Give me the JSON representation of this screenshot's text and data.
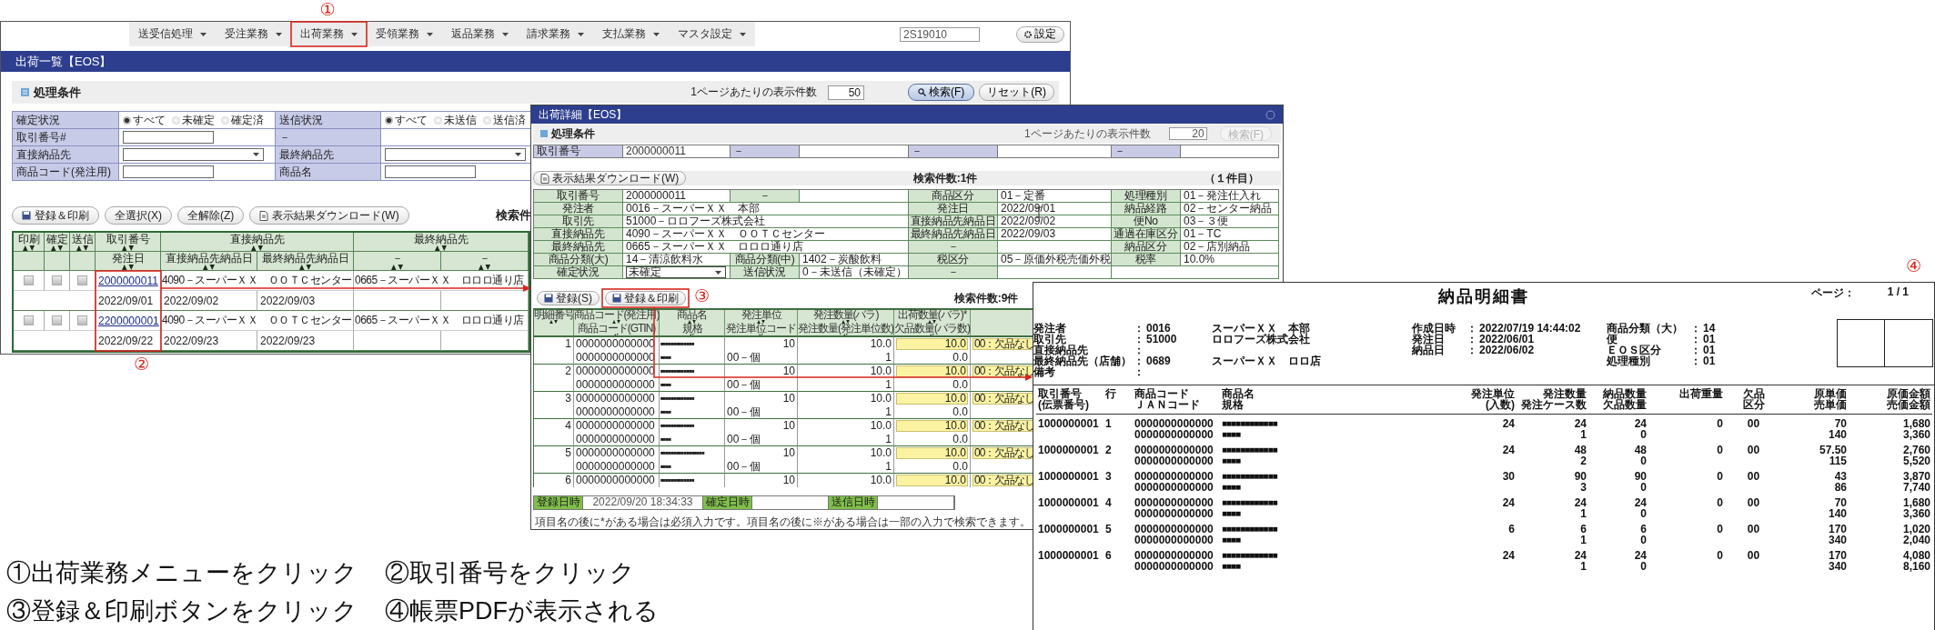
{
  "list_window": {
    "menu": [
      "送受信処理",
      "受注業務",
      "出荷業務",
      "受領業務",
      "返品業務",
      "請求業務",
      "支払業務",
      "マスタ設定"
    ],
    "user_field": "2S19010",
    "settings_button": "設定",
    "title": "出荷一覧【EOS】",
    "conditions": {
      "title": "処理条件",
      "page_size_label": "1ページあたりの表示件数",
      "page_size": "50",
      "search_button": "検索(F)",
      "reset_button": "リセット(R)",
      "rows": [
        [
          {
            "label": "確定状況",
            "kind": "radio",
            "options": [
              {
                "label": "すべて",
                "selected": true
              },
              {
                "label": "未確定",
                "selected": false
              },
              {
                "label": "確定済",
                "selected": false
              }
            ]
          },
          {
            "label": "送信状況",
            "kind": "radio",
            "options": [
              {
                "label": "すべて",
                "selected": true
              },
              {
                "label": "未送信",
                "selected": false
              },
              {
                "label": "送信済",
                "selected": false
              }
            ]
          }
        ],
        [
          {
            "label": "取引番号#",
            "kind": "input"
          },
          {
            "label": "－",
            "kind": "none"
          }
        ],
        [
          {
            "label": "直接納品先",
            "kind": "select"
          },
          {
            "label": "最終納品先",
            "kind": "select"
          }
        ],
        [
          {
            "label": "商品コード(発注用)",
            "kind": "input"
          },
          {
            "label": "商品名",
            "kind": "input"
          }
        ]
      ]
    },
    "buttons": [
      "登録＆印刷",
      "全選択(X)",
      "全解除(Z)",
      "表示結果ダウンロード(W)"
    ],
    "result_count": "検索件",
    "table": {
      "columns": [
        {
          "label": "印刷"
        },
        {
          "label": "確定"
        },
        {
          "label": "送信"
        },
        {
          "label": "取引番号",
          "sub": [
            "発注日"
          ]
        },
        {
          "label": "直接納品先",
          "sub": [
            "直接納品先納品日",
            "最終納品先納品日"
          ]
        },
        {
          "label": "最終納品先",
          "sub": [
            "－",
            "－"
          ]
        }
      ],
      "rows": [
        {
          "checks": [
            {
              "checked": false
            },
            {
              "checked": false
            },
            {
              "checked": false
            }
          ],
          "number": "2000000011",
          "direct": "4090－スーパーＸＸ　ＯＯＴＣセンター",
          "final": "0665－スーパーＸＸ　ロロロ通り店",
          "dates": [
            "2022/09/01",
            "2022/09/02",
            "2022/09/03"
          ]
        },
        {
          "checks": [
            {
              "checked": false
            },
            {
              "checked": false
            },
            {
              "checked": false
            }
          ],
          "number": "2200000001",
          "direct": "4090－スーパーＸＸ　ＯＯＴＣセンター",
          "final": "0665－スーパーＸＸ　ロロロ通り店",
          "dates": [
            "2022/09/22",
            "2022/09/23",
            "2022/09/23"
          ]
        }
      ]
    }
  },
  "detail_window": {
    "title": "出荷詳細【EOS】",
    "conditions": {
      "title": "処理条件",
      "page_size_label": "1ページあたりの表示件数",
      "page_size": "20",
      "search_button": {
        "label": "検索(F)",
        "disabled": true
      }
    },
    "key_fields": [
      {
        "label": "取引番号",
        "value": "2000000011"
      },
      {
        "label": "－"
      },
      {
        "label": "－"
      },
      {
        "label": "－"
      }
    ],
    "download_button": "表示結果ダウンロード(W)",
    "count": "検索件数:1件",
    "position": "（１件目）",
    "details": [
      [
        {
          "label": "取引番号",
          "value": "2000000011"
        },
        {
          "label": "－"
        },
        {
          "label": "商品区分",
          "value": "01－定番"
        },
        {
          "label": "処理種別",
          "value": "01－発注仕入れ"
        }
      ],
      [
        {
          "label": "発注者",
          "value": "0016－スーパーＸＸ　本部",
          "wide": true
        },
        {
          "label": "発注日",
          "value": "2022/09/01"
        },
        {
          "label": "納品経路",
          "value": "02－センター納品"
        }
      ],
      [
        {
          "label": "取引先",
          "value": "51000－ロロフーズ株式会社",
          "wide": true
        },
        {
          "label": "直接納品先納品日",
          "value": "2022/09/02"
        },
        {
          "label": "便No",
          "value": "03－３便"
        }
      ],
      [
        {
          "label": "直接納品先",
          "value": "4090－スーパーＸＸ　ＯＯＴＣセンター",
          "wide": true
        },
        {
          "label": "最終納品先納品日",
          "value": "2022/09/03"
        },
        {
          "label": "通過在庫区分",
          "value": "01－TC"
        }
      ],
      [
        {
          "label": "最終納品先",
          "value": "0665－スーパーＸＸ　ロロロ通り店",
          "wide": true
        },
        {
          "label": "－"
        },
        {
          "label": "納品区分",
          "value": "02－店別納品"
        }
      ],
      [
        {
          "label": "商品分類(大)",
          "value": "14－清涼飲料水"
        },
        {
          "label": "商品分類(中)",
          "value": "1402－炭酸飲料"
        },
        {
          "label": "税区分",
          "value": "05－原価外税売価外税"
        },
        {
          "label": "税率",
          "value": "10.0%"
        }
      ],
      [
        {
          "label": "確定状況",
          "value": "未確定",
          "kind": "select"
        },
        {
          "label": "送信状況",
          "value": "0－未送信（未確定）"
        },
        {
          "label": "－"
        }
      ]
    ],
    "actions": [
      "登録(S)",
      "登録＆印刷"
    ],
    "item_count": "検索件数:9件",
    "item_columns": [
      {
        "label": "明細番号"
      },
      {
        "label": "商品コード(発注用)",
        "sub": "商品コード(GTIN)"
      },
      {
        "label": "商品名",
        "sub": "規格"
      },
      {
        "label": "発注単位",
        "sub": "発注単位コード"
      },
      {
        "label": "発注数量(バラ)",
        "sub": "発注数量(発注単位数)"
      },
      {
        "label": "出荷数量(バラ)*",
        "sub": "欠品数量(バラ数)"
      }
    ],
    "items": [
      {
        "no": "1",
        "code": "0000000000000",
        "name": "■■■■■■■■■■■■■",
        "unit": "10",
        "qty": "10.0",
        "ship": "10.0",
        "shortage": "00：欠品なし",
        "gtin": "0000000000000",
        "spec": "■■■■",
        "unit_code": "00－個",
        "qty_units": "1",
        "short_qty": "0.0"
      },
      {
        "no": "2",
        "code": "0000000000000",
        "name": "■■■■■■■■■■■■■",
        "unit": "10",
        "qty": "10.0",
        "ship": "10.0",
        "shortage": "00：欠品なし",
        "gtin": "0000000000000",
        "spec": "■■■■",
        "unit_code": "00－個",
        "qty_units": "1",
        "short_qty": "0.0"
      },
      {
        "no": "3",
        "code": "0000000000000",
        "name": "■■■■■■■■■■■■■",
        "unit": "10",
        "qty": "10.0",
        "ship": "10.0",
        "shortage": "00：欠品なし",
        "gtin": "0000000000000",
        "spec": "■■■■",
        "unit_code": "00－個",
        "qty_units": "1",
        "short_qty": "0.0"
      },
      {
        "no": "4",
        "code": "0000000000000",
        "name": "■■■■■■■■■■■■■",
        "unit": "10",
        "qty": "10.0",
        "ship": "10.0",
        "shortage": "00：欠品なし",
        "gtin": "0000000000000",
        "spec": "■■■■",
        "unit_code": "00－個",
        "qty_units": "1",
        "short_qty": "0.0"
      },
      {
        "no": "5",
        "code": "0000000000000",
        "name": "■■■■■■■■■■■■■■■■■",
        "unit": "10",
        "qty": "10.0",
        "ship": "10.0",
        "shortage": "00：欠品なし",
        "gtin": "0000000000000",
        "spec": "■■■■",
        "unit_code": "00－個",
        "qty_units": "1",
        "short_qty": "0.0"
      },
      {
        "no": "6",
        "code": "0000000000000",
        "name": "■■■■■■■■■■■■■",
        "unit": "10",
        "qty": "10.0",
        "ship": "10.0",
        "shortage": "00：欠品なし"
      }
    ],
    "footer": [
      {
        "label": "登録日時",
        "value": "2022/09/20 18:34:33"
      },
      {
        "label": "確定日時"
      },
      {
        "label": "送信日時"
      }
    ],
    "note": "項目名の後に*がある場合は必須入力です。項目名の後に※がある場合は一部の入力で検索できます。"
  },
  "pdf": {
    "title": "納品明細書",
    "page_label": "ページ：",
    "page": "1 / 1",
    "meta_left": [
      {
        "label": "発注者",
        "colon": "：",
        "value": "0016",
        "name": "スーパーＸＸ　本部"
      },
      {
        "label": "取引先",
        "colon": "：",
        "value": "51000",
        "name": "ロロフーズ株式会社"
      },
      {
        "label": "直接納品先",
        "colon": "："
      },
      {
        "label": "最終納品先（店舗）",
        "colon": "：",
        "value": "0689",
        "name": "スーパーＸＸ　ロロ店"
      },
      {
        "label": "備考",
        "colon": "："
      }
    ],
    "meta_middle": [
      {
        "label": "作成日時",
        "colon": "：",
        "value": "2022/07/19 14:44:02"
      },
      {
        "label": "発注日",
        "colon": "：",
        "value": "2022/06/01"
      },
      {
        "label": "納品日",
        "colon": "：",
        "value": "2022/06/02"
      }
    ],
    "meta_right": [
      {
        "label": "商品分類（大）",
        "colon": "：",
        "value": "14"
      },
      {
        "label": "便",
        "colon": "：",
        "value": "01"
      },
      {
        "label": "ＥＯＳ区分",
        "colon": "：",
        "value": "01"
      },
      {
        "label": "処理種別",
        "colon": "：",
        "value": "01"
      }
    ],
    "columns": [
      {
        "label": "取引番号",
        "sub": "(伝票番号)"
      },
      {
        "label": "行"
      },
      {
        "label": "商品コード",
        "sub": "ＪＡＮコード"
      },
      {
        "label": "商品名",
        "sub": "規格"
      },
      {
        "label": "発注単位",
        "sub": "(入数)"
      },
      {
        "label": "発注数量",
        "sub": "発注ケース数"
      },
      {
        "label": "納品数量",
        "sub": "欠品数量"
      },
      {
        "label": "出荷重量"
      },
      {
        "label": "欠品",
        "sub": "区分"
      },
      {
        "label": "原単価",
        "sub": "売単価"
      },
      {
        "label": "原価金額",
        "sub": "売価金額"
      }
    ],
    "rows": [
      {
        "slip": "1000000001",
        "line": "1",
        "code": "0000000000000",
        "jan": "0000000000000",
        "name": "■■■■■■■■■■■■",
        "spec": "■■■■",
        "unit": "24",
        "order": "24",
        "cases": "1",
        "delivered": "24",
        "short": "0",
        "weight": "0",
        "shortage": "00",
        "cost": "70",
        "price": "140",
        "cost_amount": "1,680",
        "price_amount": "3,360"
      },
      {
        "slip": "1000000001",
        "line": "2",
        "code": "0000000000000",
        "jan": "0000000000000",
        "name": "■■■■■■■■■■■■",
        "spec": "■■■■",
        "unit": "24",
        "order": "48",
        "cases": "2",
        "delivered": "48",
        "short": "0",
        "weight": "0",
        "shortage": "00",
        "cost": "57.50",
        "price": "115",
        "cost_amount": "2,760",
        "price_amount": "5,520"
      },
      {
        "slip": "1000000001",
        "line": "3",
        "code": "0000000000000",
        "jan": "0000000000000",
        "name": "■■■■■■■■■■■■",
        "spec": "■■■■",
        "unit": "30",
        "order": "90",
        "cases": "3",
        "delivered": "90",
        "short": "0",
        "weight": "0",
        "shortage": "00",
        "cost": "43",
        "price": "86",
        "cost_amount": "3,870",
        "price_amount": "7,740"
      },
      {
        "slip": "1000000001",
        "line": "4",
        "code": "0000000000000",
        "jan": "0000000000000",
        "name": "■■■■■■■■■■■■",
        "spec": "■■■■",
        "unit": "24",
        "order": "24",
        "cases": "1",
        "delivered": "24",
        "short": "0",
        "weight": "0",
        "shortage": "00",
        "cost": "70",
        "price": "140",
        "cost_amount": "1,680",
        "price_amount": "3,360"
      },
      {
        "slip": "1000000001",
        "line": "5",
        "code": "0000000000000",
        "jan": "0000000000000",
        "name": "■■■■■■■■■■■■",
        "spec": "■■■■",
        "unit": "6",
        "order": "6",
        "cases": "1",
        "delivered": "6",
        "short": "0",
        "weight": "0",
        "shortage": "00",
        "cost": "170",
        "price": "340",
        "cost_amount": "1,020",
        "price_amount": "2,040"
      },
      {
        "slip": "1000000001",
        "line": "6",
        "code": "0000000000000",
        "jan": "0000000000000",
        "name": "■■■■■■■■■■■■",
        "spec": "■■■■",
        "unit": "24",
        "order": "24",
        "cases": "1",
        "delivered": "24",
        "short": "0",
        "weight": "0",
        "shortage": "00",
        "cost": "170",
        "price": "340",
        "cost_amount": "4,080",
        "price_amount": "8,160"
      }
    ]
  },
  "annotations": {
    "markers": [
      "①",
      "②",
      "③",
      "④"
    ],
    "captions": [
      "①出荷業務メニューをクリック",
      "②取引番号をクリック",
      "③登録＆印刷ボタンをクリック",
      "④帳票PDFが表示される"
    ]
  }
}
